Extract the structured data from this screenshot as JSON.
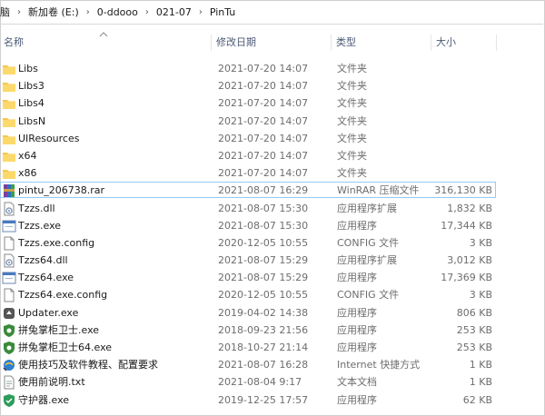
{
  "breadcrumb": [
    "脑",
    "新加卷 (E:)",
    "0-ddooo",
    "021-07",
    "PinTu"
  ],
  "columns": {
    "name": "名称",
    "date": "修改日期",
    "type": "类型",
    "size": "大小"
  },
  "colors": {
    "folder": "#f7c74a",
    "accent": "#99c9ef"
  },
  "files": [
    {
      "icon": "folder-icon",
      "name": "Libs",
      "date": "2021-07-20 14:07",
      "type": "文件夹",
      "size": ""
    },
    {
      "icon": "folder-icon",
      "name": "Libs3",
      "date": "2021-07-20 14:07",
      "type": "文件夹",
      "size": ""
    },
    {
      "icon": "folder-icon",
      "name": "Libs4",
      "date": "2021-07-20 14:07",
      "type": "文件夹",
      "size": ""
    },
    {
      "icon": "folder-icon",
      "name": "LibsN",
      "date": "2021-07-20 14:07",
      "type": "文件夹",
      "size": ""
    },
    {
      "icon": "folder-icon",
      "name": "UIResources",
      "date": "2021-07-20 14:07",
      "type": "文件夹",
      "size": ""
    },
    {
      "icon": "folder-icon",
      "name": "x64",
      "date": "2021-07-20 14:07",
      "type": "文件夹",
      "size": ""
    },
    {
      "icon": "folder-icon",
      "name": "x86",
      "date": "2021-07-20 14:07",
      "type": "文件夹",
      "size": ""
    },
    {
      "icon": "winrar-archive-icon",
      "name": "pintu_206738.rar",
      "date": "2021-08-07 16:29",
      "type": "WinRAR 压缩文件",
      "size": "316,130 KB",
      "selected": true
    },
    {
      "icon": "dll-file-icon",
      "name": "Tzzs.dll",
      "date": "2021-08-07 15:30",
      "type": "应用程序扩展",
      "size": "1,832 KB"
    },
    {
      "icon": "app-exe-icon",
      "name": "Tzzs.exe",
      "date": "2021-08-07 15:30",
      "type": "应用程序",
      "size": "17,344 KB"
    },
    {
      "icon": "config-file-icon",
      "name": "Tzzs.exe.config",
      "date": "2020-12-05 10:55",
      "type": "CONFIG 文件",
      "size": "3 KB"
    },
    {
      "icon": "dll-file-icon",
      "name": "Tzzs64.dll",
      "date": "2021-08-07 15:29",
      "type": "应用程序扩展",
      "size": "3,012 KB"
    },
    {
      "icon": "app-exe-icon",
      "name": "Tzzs64.exe",
      "date": "2021-08-07 15:29",
      "type": "应用程序",
      "size": "17,369 KB"
    },
    {
      "icon": "config-file-icon",
      "name": "Tzzs64.exe.config",
      "date": "2020-12-05 10:55",
      "type": "CONFIG 文件",
      "size": "3 KB"
    },
    {
      "icon": "updater-icon",
      "name": "Updater.exe",
      "date": "2019-04-02 14:38",
      "type": "应用程序",
      "size": "806 KB"
    },
    {
      "icon": "guard-exe-icon",
      "name": "拼兔掌柜卫士.exe",
      "date": "2018-09-23 21:56",
      "type": "应用程序",
      "size": "253 KB"
    },
    {
      "icon": "guard-exe-icon",
      "name": "拼兔掌柜卫士64.exe",
      "date": "2018-10-27 21:14",
      "type": "应用程序",
      "size": "253 KB"
    },
    {
      "icon": "internet-shortcut-icon",
      "name": "使用技巧及软件教程、配置要求",
      "date": "2021-08-07 16:28",
      "type": "Internet 快捷方式",
      "size": "1 KB"
    },
    {
      "icon": "text-file-icon",
      "name": "使用前说明.txt",
      "date": "2021-08-04 9:17",
      "type": "文本文档",
      "size": "1 KB"
    },
    {
      "icon": "shield-exe-icon",
      "name": "守护器.exe",
      "date": "2019-12-25 17:57",
      "type": "应用程序",
      "size": "62 KB"
    }
  ]
}
